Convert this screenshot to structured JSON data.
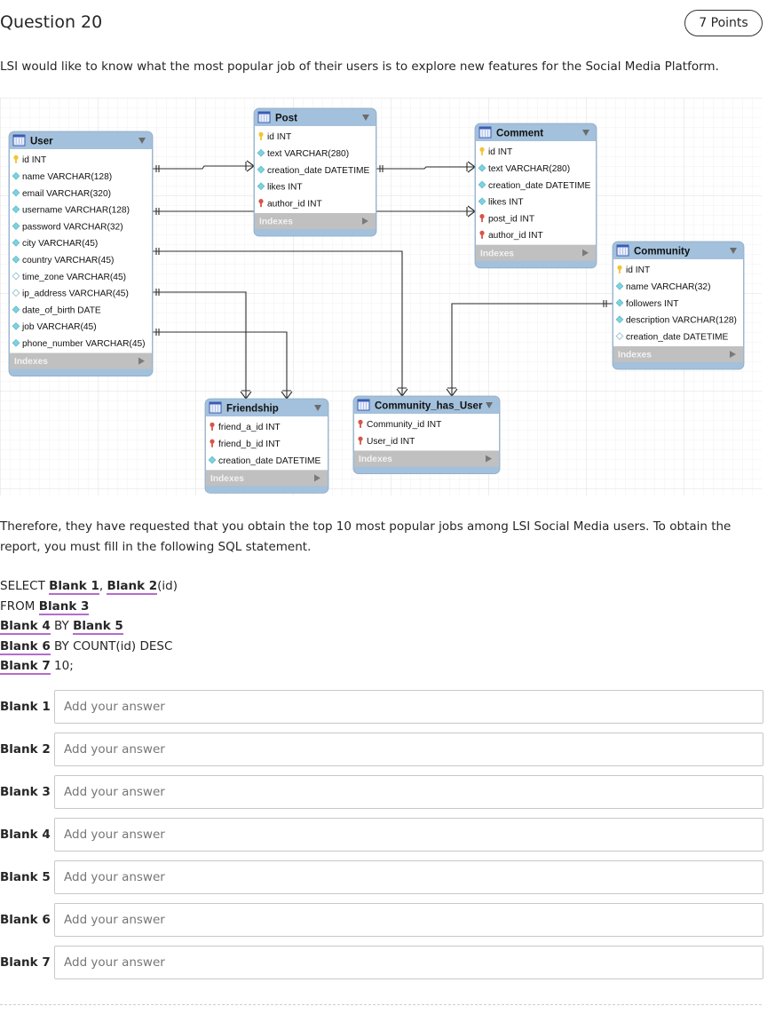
{
  "question": {
    "title": "Question 20",
    "points": "7 Points",
    "intro": "LSI would like to know what the most popular job of their users is to explore new features for the Social Media Platform.",
    "paragraph2": "Therefore, they have requested that you obtain the top 10 most popular jobs among LSI Social Media users. To obtain the report, you must fill in the following SQL statement."
  },
  "diagram": {
    "indexes_label": "Indexes",
    "tables": [
      {
        "name": "User",
        "columns": [
          {
            "text": "id INT",
            "icon": "primary-key"
          },
          {
            "text": "name VARCHAR(128)",
            "icon": "column-filled"
          },
          {
            "text": "email VARCHAR(320)",
            "icon": "column-filled"
          },
          {
            "text": "username VARCHAR(128)",
            "icon": "column-filled"
          },
          {
            "text": "password VARCHAR(32)",
            "icon": "column-filled"
          },
          {
            "text": "city VARCHAR(45)",
            "icon": "column-filled"
          },
          {
            "text": "country VARCHAR(45)",
            "icon": "column-filled"
          },
          {
            "text": "time_zone VARCHAR(45)",
            "icon": "column-empty"
          },
          {
            "text": "ip_address VARCHAR(45)",
            "icon": "column-empty"
          },
          {
            "text": "date_of_birth DATE",
            "icon": "column-filled"
          },
          {
            "text": "job VARCHAR(45)",
            "icon": "column-filled"
          },
          {
            "text": "phone_number VARCHAR(45)",
            "icon": "column-filled"
          }
        ]
      },
      {
        "name": "Post",
        "columns": [
          {
            "text": "id INT",
            "icon": "primary-key"
          },
          {
            "text": "text VARCHAR(280)",
            "icon": "column-filled"
          },
          {
            "text": "creation_date DATETIME",
            "icon": "column-filled"
          },
          {
            "text": "likes INT",
            "icon": "column-filled"
          },
          {
            "text": "author_id INT",
            "icon": "foreign-key"
          }
        ]
      },
      {
        "name": "Comment",
        "columns": [
          {
            "text": "id INT",
            "icon": "primary-key"
          },
          {
            "text": "text VARCHAR(280)",
            "icon": "column-filled"
          },
          {
            "text": "creation_date DATETIME",
            "icon": "column-filled"
          },
          {
            "text": "likes INT",
            "icon": "column-filled"
          },
          {
            "text": "post_id INT",
            "icon": "foreign-key"
          },
          {
            "text": "author_id INT",
            "icon": "foreign-key"
          }
        ]
      },
      {
        "name": "Community",
        "columns": [
          {
            "text": "id INT",
            "icon": "primary-key"
          },
          {
            "text": "name VARCHAR(32)",
            "icon": "column-filled"
          },
          {
            "text": "followers INT",
            "icon": "column-filled"
          },
          {
            "text": "description VARCHAR(128)",
            "icon": "column-filled"
          },
          {
            "text": "creation_date DATETIME",
            "icon": "column-empty"
          }
        ]
      },
      {
        "name": "Friendship",
        "columns": [
          {
            "text": "friend_a_id INT",
            "icon": "foreign-key"
          },
          {
            "text": "friend_b_id INT",
            "icon": "foreign-key"
          },
          {
            "text": "creation_date DATETIME",
            "icon": "column-filled"
          }
        ]
      },
      {
        "name": "Community_has_User",
        "columns": [
          {
            "text": "Community_id INT",
            "icon": "foreign-key"
          },
          {
            "text": "User_id INT",
            "icon": "foreign-key"
          }
        ]
      }
    ],
    "relationships": [
      {
        "from": "User",
        "to": "Post",
        "type": "one-to-many"
      },
      {
        "from": "User",
        "to": "Comment",
        "type": "one-to-many"
      },
      {
        "from": "Post",
        "to": "Comment",
        "type": "one-to-many"
      },
      {
        "from": "User",
        "to": "Community_has_User",
        "type": "one-to-many"
      },
      {
        "from": "Community",
        "to": "Community_has_User",
        "type": "one-to-many"
      },
      {
        "from": "User",
        "to": "Friendship",
        "type": "one-to-many"
      },
      {
        "from": "User",
        "to": "Friendship",
        "type": "one-to-many"
      }
    ]
  },
  "sql": {
    "lines": [
      [
        {
          "t": "SELECT "
        },
        {
          "b": "Blank 1"
        },
        {
          "t": ", "
        },
        {
          "b": "Blank 2"
        },
        {
          "t": "(id)"
        }
      ],
      [
        {
          "t": "FROM "
        },
        {
          "b": "Blank 3"
        }
      ],
      [
        {
          "b": "Blank 4"
        },
        {
          "t": " BY "
        },
        {
          "b": "Blank 5"
        }
      ],
      [
        {
          "b": "Blank 6"
        },
        {
          "t": " BY COUNT(id) DESC"
        }
      ],
      [
        {
          "b": "Blank 7"
        },
        {
          "t": " 10;"
        }
      ]
    ]
  },
  "answers": [
    {
      "label": "Blank 1",
      "value": "",
      "placeholder": "Add your answer"
    },
    {
      "label": "Blank 2",
      "value": "",
      "placeholder": "Add your answer"
    },
    {
      "label": "Blank 3",
      "value": "",
      "placeholder": "Add your answer"
    },
    {
      "label": "Blank 4",
      "value": "",
      "placeholder": "Add your answer"
    },
    {
      "label": "Blank 5",
      "value": "",
      "placeholder": "Add your answer"
    },
    {
      "label": "Blank 6",
      "value": "",
      "placeholder": "Add your answer"
    },
    {
      "label": "Blank 7",
      "value": "",
      "placeholder": "Add your answer"
    }
  ],
  "colors": {
    "table_header": "#a3c1dc",
    "indexes_bar": "#c0c0c0",
    "blank_underline": "#b56ccc",
    "primary_key": "#f2c531",
    "foreign_key": "#d9534a",
    "column_icon": "#7dd3df"
  }
}
